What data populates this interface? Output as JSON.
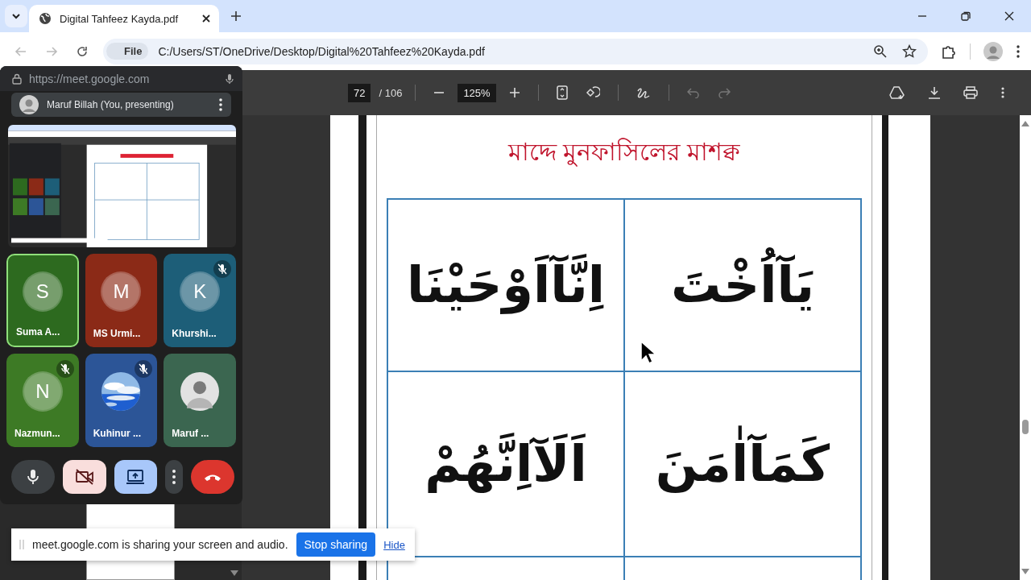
{
  "browser": {
    "tab": {
      "title": "Digital Tahfeez Kayda.pdf"
    },
    "address": {
      "chip": "File",
      "url": "C:/Users/ST/OneDrive/Desktop/Digital%20Tahfeez%20Kayda.pdf"
    }
  },
  "pdf_toolbar": {
    "page": "72",
    "page_count": "/ 106",
    "zoom": "125%"
  },
  "pdf_page": {
    "heading": "মাদ্দে মুনফাসিলের মাশক্ব",
    "cells": [
      "اِنَّآاَوْحَيْنَا",
      "يَآاُخْتَ",
      "اَلَآاِنَّهُمْ",
      "كَمَآاٰمَنَ"
    ]
  },
  "meet": {
    "url": "https://meet.google.com",
    "presenter": "Maruf Billah (You, presenting)",
    "participants": [
      {
        "kind": "initial",
        "name": "Suma A...",
        "initial": "S",
        "color": "#2d6a1f",
        "muted": false,
        "speaking": true
      },
      {
        "kind": "initial",
        "name": "MS Urmi...",
        "initial": "M",
        "color": "#8b2a17",
        "muted": false,
        "speaking": false
      },
      {
        "kind": "initial",
        "name": "Khurshi...",
        "initial": "K",
        "color": "#1d5e78",
        "muted": true,
        "speaking": false
      },
      {
        "kind": "initial",
        "name": "Nazmun...",
        "initial": "N",
        "color": "#3d7a25",
        "muted": true,
        "speaking": false
      },
      {
        "kind": "picture",
        "name": "Kuhinur ...",
        "color": "#2c5597",
        "muted": true,
        "speaking": false
      },
      {
        "kind": "person",
        "name": "Maruf ...",
        "color": "#3b6650",
        "muted": false,
        "speaking": false
      }
    ],
    "controls": [
      {
        "kind": "mic"
      },
      {
        "kind": "camera"
      },
      {
        "kind": "present"
      },
      {
        "kind": "more"
      },
      {
        "kind": "leave"
      }
    ]
  },
  "share_bar": {
    "message": "meet.google.com is sharing your screen and audio.",
    "stop": "Stop sharing",
    "hide": "Hide"
  }
}
